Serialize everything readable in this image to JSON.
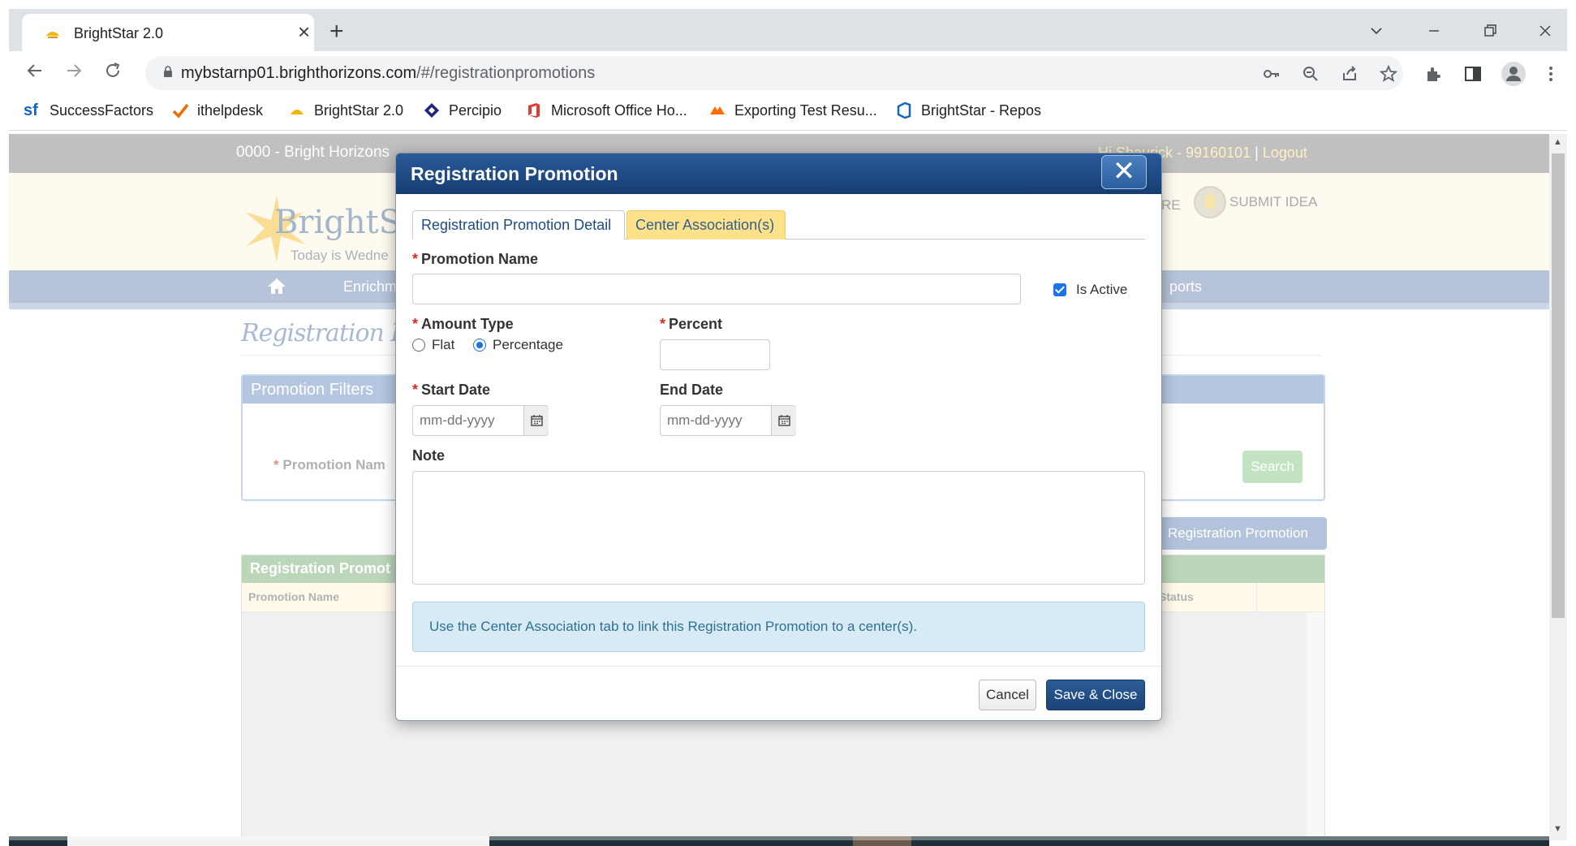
{
  "browser": {
    "tab_title": "BrightStar 2.0",
    "url_host": "mybstarnp01.brighthorizons.com",
    "url_path": "/#/registrationpromotions",
    "bookmarks": [
      {
        "label": "SuccessFactors",
        "icon": "successfactors-icon"
      },
      {
        "label": "ithelpdesk",
        "icon": "checkmark-icon"
      },
      {
        "label": "BrightStar 2.0",
        "icon": "brightstar-icon"
      },
      {
        "label": "Percipio",
        "icon": "percipio-icon"
      },
      {
        "label": "Microsoft Office Ho...",
        "icon": "office-icon"
      },
      {
        "label": "Exporting Test Resu...",
        "icon": "postman-icon"
      },
      {
        "label": "BrightStar - Repos",
        "icon": "azure-repos-icon"
      }
    ]
  },
  "app": {
    "center_label": "0000 - Bright Horizons",
    "user_label": "Hi Shaurick - 99160101",
    "logout_label": "Logout",
    "logo_text": "BrightSta",
    "today_text": "Today is Wedne",
    "re_label": "RE",
    "submit_idea_label": "SUBMIT IDEA",
    "nav_items": [
      {
        "label": "Enrichm"
      },
      {
        "label": "ports"
      }
    ],
    "page_title": "Registration Promo",
    "filters_title": "Promotion Filters",
    "filter_promotion_label": "Promotion Nam",
    "search_label": "Search",
    "add_button_label": "Registration Promotion",
    "grid_title": "Registration Promot",
    "grid_columns": [
      "Promotion Name",
      "Status"
    ]
  },
  "modal": {
    "title": "Registration Promotion",
    "close_glyph": "✕",
    "tabs": [
      {
        "label": "Registration Promotion Detail",
        "active": true
      },
      {
        "label": "Center Association(s)",
        "active": false
      }
    ],
    "promotion_name_label": "Promotion Name",
    "promotion_name_value": "",
    "is_active_label": "Is Active",
    "is_active": true,
    "amount_type_label": "Amount Type",
    "amount_type_options": [
      "Flat",
      "Percentage"
    ],
    "amount_type_selected": "Percentage",
    "percent_label": "Percent",
    "percent_value": "",
    "start_date_label": "Start Date",
    "start_date_placeholder": "mm-dd-yyyy",
    "end_date_label": "End Date",
    "end_date_placeholder": "mm-dd-yyyy",
    "note_label": "Note",
    "note_value": "",
    "info_text": "Use the Center Association tab to link this Registration Promotion to a center(s).",
    "cancel_label": "Cancel",
    "save_label": "Save & Close"
  },
  "colors": {
    "modal_header": "#1f4a85",
    "inactive_tab": "#fde28b",
    "info_bg": "#d6ebf5",
    "required": "#d62d20",
    "primary_button": "#1a4377"
  }
}
